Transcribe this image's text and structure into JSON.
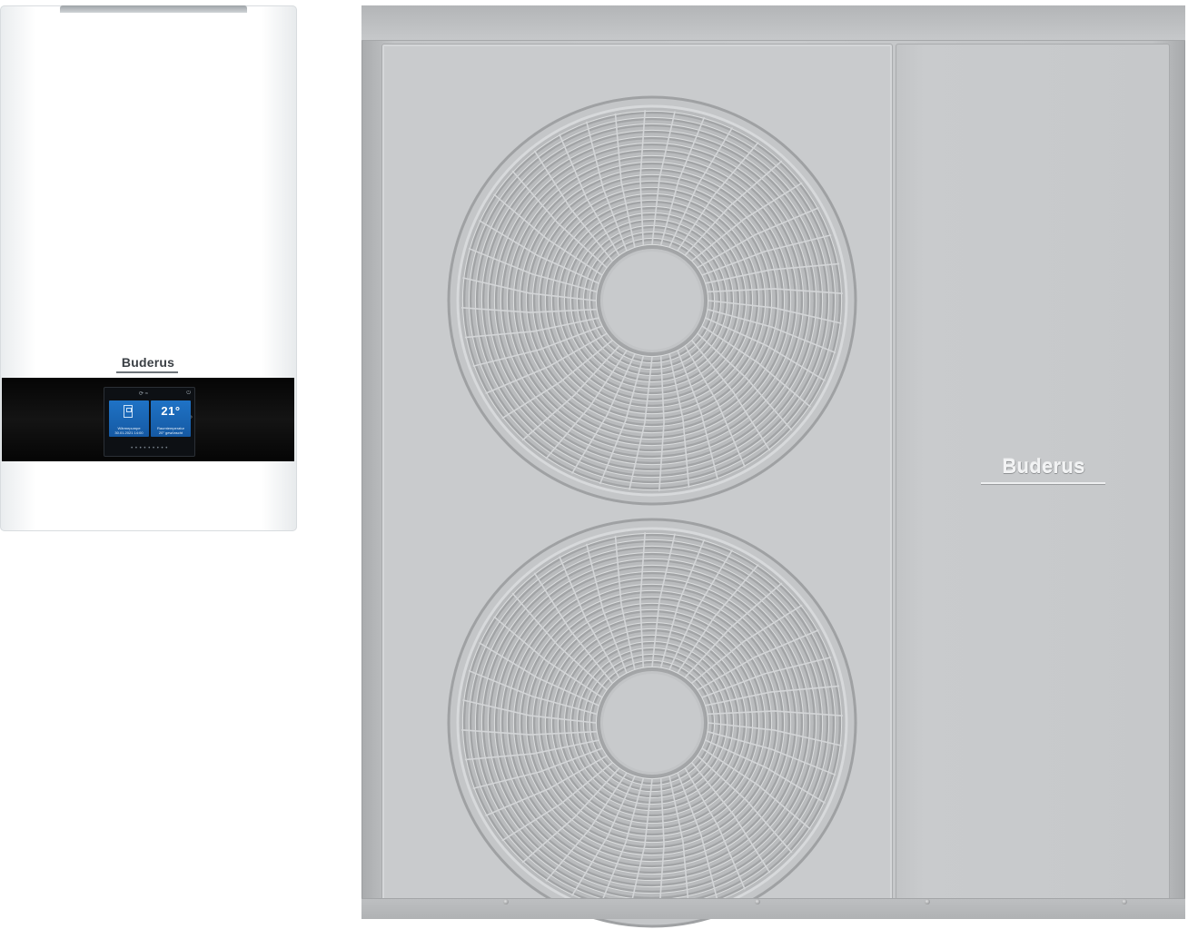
{
  "indoor_unit": {
    "brand": "Buderus",
    "display": {
      "status_connection": "⟳ ≈",
      "status_power": "⏻",
      "tile_left": {
        "icon": "heat-pump-icon",
        "line1": "Wärmepumpe",
        "line2": "30.01.2021 14:00"
      },
      "tile_right": {
        "temperature": "21°",
        "line1": "Raumtemperatur",
        "line2": "20° gewünscht"
      },
      "pager": "• • • • • • • • •",
      "next": "›"
    }
  },
  "outdoor_unit": {
    "brand": "Buderus"
  },
  "colors": {
    "indoor_body": "#ffffff",
    "indoor_band": "#0a0a0a",
    "display_tile": "#1a66b5",
    "outdoor_body": "#c8cacc",
    "grille": "#a2a4a6"
  }
}
